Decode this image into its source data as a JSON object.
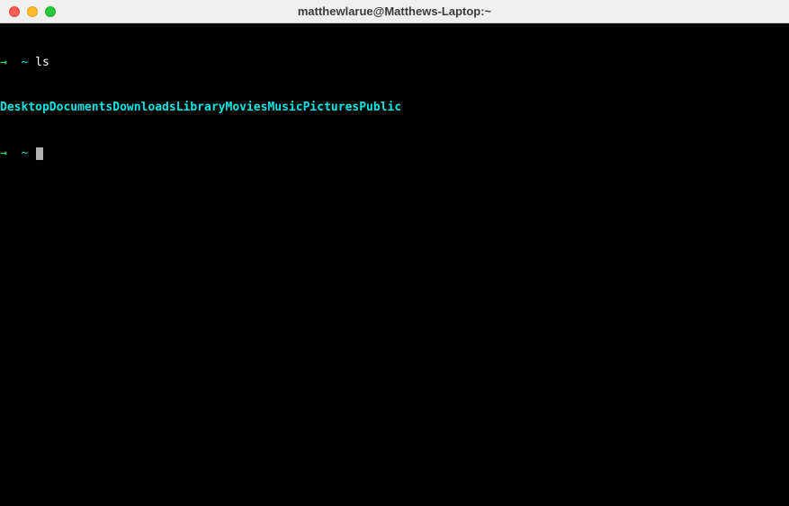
{
  "window": {
    "title": "matthewlarue@Matthews-Laptop:~"
  },
  "prompt": {
    "arrow": "→",
    "tilde": "~",
    "command": "ls"
  },
  "ls_output": {
    "items": [
      "Desktop",
      "Documents",
      "Downloads",
      "Library",
      "Movies",
      "Music",
      "Pictures",
      "Public"
    ]
  },
  "colors": {
    "traffic_red": "#ff5f56",
    "traffic_yellow": "#ffbd2e",
    "traffic_green": "#27c93f",
    "terminal_bg": "#000000",
    "prompt_arrow": "#00ff87",
    "directory": "#00e5e5"
  }
}
